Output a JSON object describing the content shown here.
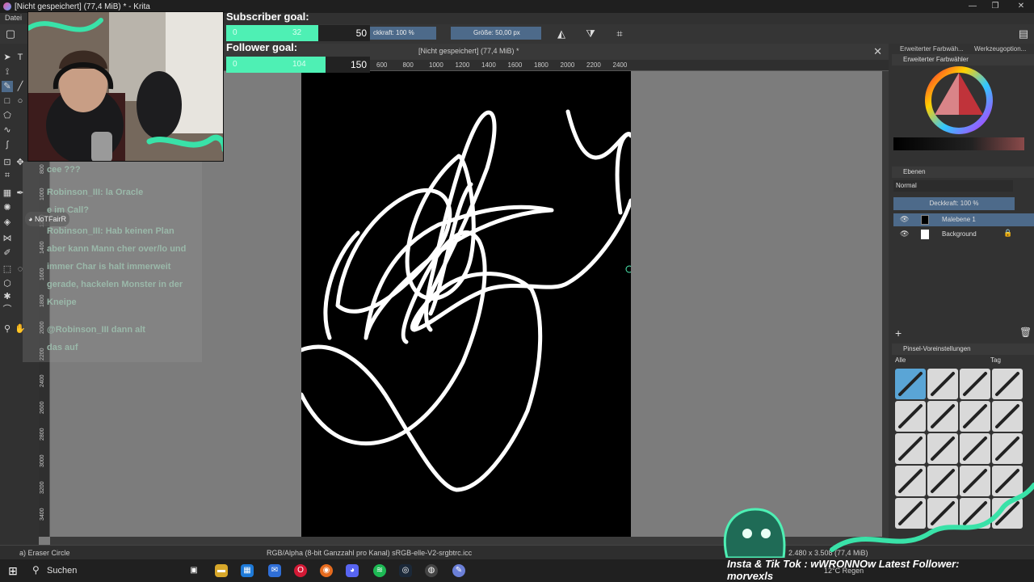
{
  "window": {
    "title": "[Nicht gespeichert]  (77,4 MiB) * - Krita",
    "minimize": "—",
    "restore": "❐",
    "close": "✕"
  },
  "menu": {
    "file": "Datei"
  },
  "toolbar": {
    "opacity_label": "ckkraft: 100 %",
    "size_label": "Größe: 50,00 px"
  },
  "document": {
    "tab_title": "[Nicht gespeichert]  (77,4 MiB) *",
    "close": "✕"
  },
  "ruler": {
    "h": [
      "600",
      "800",
      "1000",
      "1200",
      "1400",
      "1600",
      "1800",
      "2000",
      "2200",
      "2400"
    ],
    "v": [
      "200",
      "400",
      "600",
      "800",
      "1000",
      "1200",
      "1400",
      "1600",
      "1800",
      "2000",
      "2200",
      "2400",
      "2600",
      "2800",
      "3000",
      "3200",
      "3400"
    ]
  },
  "dock": {
    "tab_color": "Erweiterter Farbwäh...",
    "tab_tools": "Werkzeugoption...",
    "color_panel": "Erweiterter Farbwähler",
    "layers_panel": "Ebenen",
    "blend_mode": "Normal",
    "opacity": "Deckkraft: 100 %",
    "layers": [
      {
        "name": "Malebene 1",
        "selected": true
      },
      {
        "name": "Background",
        "selected": false
      }
    ],
    "brush_panel": "Pinsel-Voreinstellungen",
    "brush_filter": "Alle",
    "brush_tag": "Tag"
  },
  "status": {
    "brush": "a) Eraser Circle",
    "color_profile": "RGB/Alpha (8-bit Ganzzahl pro Kanal)  sRGB-elle-V2-srgbtrc.icc",
    "dims": "2.480 x 3.508 (77,4 MiB)"
  },
  "taskbar": {
    "search": "Suchen",
    "weather": "12°C  Regen"
  },
  "overlay": {
    "subscriber_title": "Subscriber goal:",
    "subscriber_start": "0",
    "subscriber_current": "32",
    "subscriber_target": "50",
    "subscriber_progress": 0.64,
    "follower_title": "Follower goal:",
    "follower_start": "0",
    "follower_current": "104",
    "follower_target": "150",
    "follower_progress": 0.69,
    "chat_user": "NoTFairR",
    "chat_lines": [
      "cee ???",
      "Robinson_III: la Oracle",
      "e im Call?",
      "Robinson_III: Hab keinen Plan",
      "aber kann Mann cher over/lo und",
      "immer Char is halt immerweit",
      "gerade, hackelen Monster in der",
      "Kneipe",
      "@Robinson_III dann alt",
      "das auf"
    ],
    "ticker": "Insta & Tik Tok : wWRONNOw   Latest Follower: morvexls"
  },
  "colors": {
    "accent": "#4ef0b4",
    "selection": "#4d6a8a",
    "canvas_bg": "#7c7c7c"
  }
}
